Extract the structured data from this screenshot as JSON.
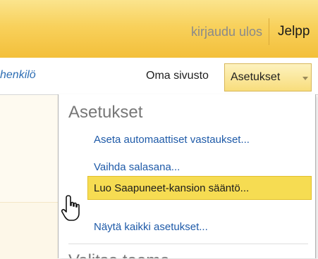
{
  "header": {
    "logout_label": "kirjaudu ulos",
    "help_label": "Jelpp"
  },
  "nav": {
    "person_link": "henkilö",
    "own_site": "Oma sivusto",
    "settings_tab": "Asetukset"
  },
  "settings_menu": {
    "title": "Asetukset",
    "items": [
      {
        "label": "Aseta automaattiset vastaukset..."
      },
      {
        "label": "Vaihda salasana..."
      },
      {
        "label": "Luo Saapuneet-kansion sääntö...",
        "highlighted": true
      },
      {
        "label": "Näytä kaikki asetukset..."
      }
    ],
    "next_section_title": "Valitse teema"
  },
  "colors": {
    "accent_yellow": "#f8d15c",
    "link_blue": "#1e5aa8",
    "highlight": "#f6dc52"
  },
  "icons": {
    "cursor": "hand-pointer-icon",
    "dropdown": "caret-down-icon"
  }
}
